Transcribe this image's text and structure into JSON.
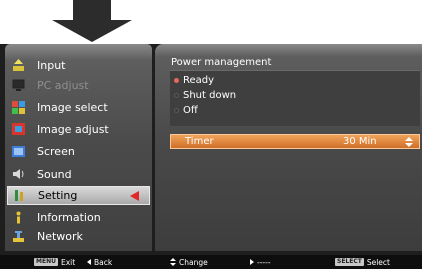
{
  "menu": {
    "items": [
      {
        "label": "Input",
        "icon": "input-icon",
        "state": "normal"
      },
      {
        "label": "PC adjust",
        "icon": "pc-adjust-icon",
        "state": "disabled"
      },
      {
        "label": "Image select",
        "icon": "image-select-icon",
        "state": "normal"
      },
      {
        "label": "Image adjust",
        "icon": "image-adjust-icon",
        "state": "normal"
      },
      {
        "label": "Screen",
        "icon": "screen-icon",
        "state": "normal"
      },
      {
        "label": "Sound",
        "icon": "sound-icon",
        "state": "normal"
      },
      {
        "label": "Setting",
        "icon": "setting-icon",
        "state": "selected"
      },
      {
        "label": "Information",
        "icon": "information-icon",
        "state": "normal"
      },
      {
        "label": "Network",
        "icon": "network-icon",
        "state": "normal"
      }
    ]
  },
  "panel": {
    "title": "Power management",
    "options": [
      {
        "label": "Ready",
        "selected": true
      },
      {
        "label": "Shut down",
        "selected": false
      },
      {
        "label": "Off",
        "selected": false
      }
    ],
    "timer": {
      "label": "Timer",
      "value": "30 Min"
    }
  },
  "footer": {
    "exit": {
      "key": "MENU",
      "label": "Exit"
    },
    "back": {
      "label": "Back"
    },
    "change": {
      "label": "Change"
    },
    "next": {
      "label": "-----"
    },
    "select": {
      "key": "SELECT",
      "label": "Select"
    }
  },
  "colors": {
    "accent": "#e2262a",
    "highlight": "#e07e36"
  }
}
